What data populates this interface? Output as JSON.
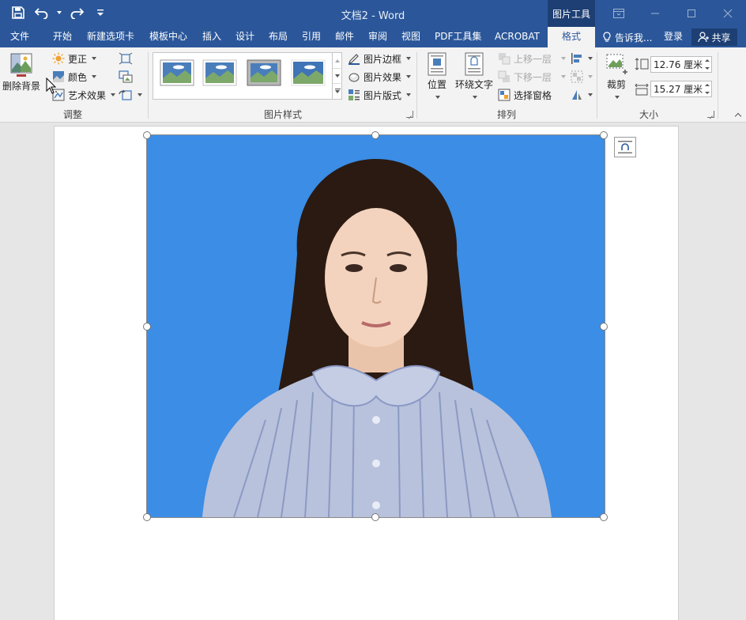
{
  "window": {
    "title": "文档2 - Word",
    "context_tab_group": "图片工具"
  },
  "tabs": [
    "文件",
    "开始",
    "新建选项卡",
    "模板中心",
    "插入",
    "设计",
    "布局",
    "引用",
    "邮件",
    "审阅",
    "视图",
    "PDF工具集",
    "ACROBAT",
    "格式"
  ],
  "active_tab": "格式",
  "tell_me": "告诉我...",
  "login": "登录",
  "share": "共享",
  "ribbon": {
    "adjust": {
      "remove_bg": "删除背景",
      "corrections": "更正",
      "color": "颜色",
      "artistic": "艺术效果",
      "label": "调整"
    },
    "styles": {
      "border": "图片边框",
      "effects": "图片效果",
      "layout": "图片版式",
      "label": "图片样式"
    },
    "arrange": {
      "position": "位置",
      "wrap": "环绕文字",
      "bring_forward": "上移一层",
      "send_backward": "下移一层",
      "selection_pane": "选择窗格",
      "label": "排列"
    },
    "size": {
      "crop": "裁剪",
      "height": "12.76 厘米",
      "width": "15.27 厘米",
      "label": "大小"
    }
  },
  "colors": {
    "brand": "#2b579a",
    "photo_background": "#3b8de6"
  },
  "icons": [
    "save-icon",
    "undo-icon",
    "redo-icon",
    "customize-qat-icon",
    "ribbon-display-icon",
    "minimize-icon",
    "maximize-icon",
    "close-icon",
    "lightbulb-icon",
    "person-icon",
    "remove-background-icon",
    "sun-icon",
    "palette-icon",
    "artistic-effects-icon",
    "compress-icon",
    "change-picture-icon",
    "reset-picture-icon",
    "border-pen-icon",
    "effects-icon",
    "picture-layout-icon",
    "position-icon",
    "wrap-text-icon",
    "bring-forward-icon",
    "send-backward-icon",
    "selection-pane-icon",
    "align-icon",
    "group-icon",
    "rotate-icon",
    "crop-icon",
    "height-icon",
    "width-icon",
    "layout-options-icon",
    "collapse-ribbon-icon",
    "mouse-cursor-icon"
  ]
}
